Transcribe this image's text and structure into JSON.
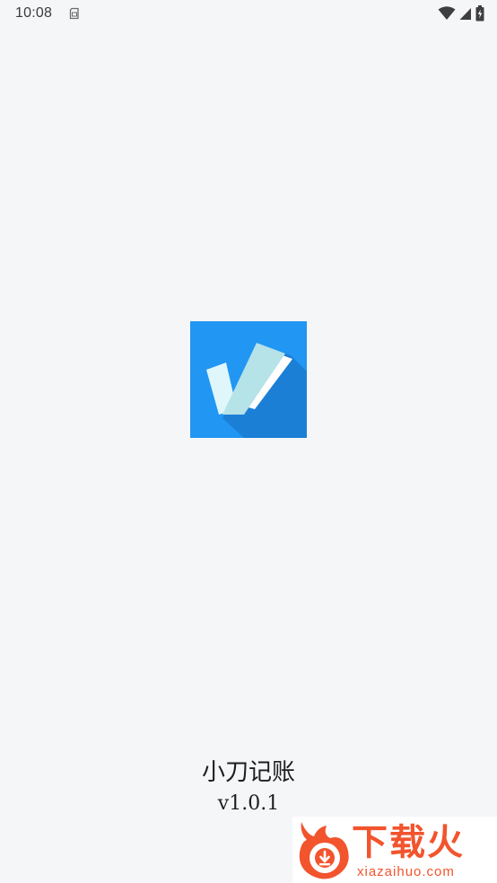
{
  "status_bar": {
    "time": "10:08",
    "icons": [
      "sim-card-icon",
      "wifi-icon",
      "cell-signal-icon",
      "battery-charging-icon"
    ]
  },
  "splash": {
    "logo_icon": "checkmark-app-icon",
    "app_name": "小刀记账",
    "version": "v1.0.1"
  },
  "watermark": {
    "title": "下载火",
    "url": "xiazaihuo.com",
    "icon": "flame-download-icon"
  },
  "colors": {
    "background": "#f5f6f8",
    "icon_blue": "#2196f3",
    "icon_shadow": "#1b7fd6",
    "watermark_orange": "#f2542d"
  }
}
